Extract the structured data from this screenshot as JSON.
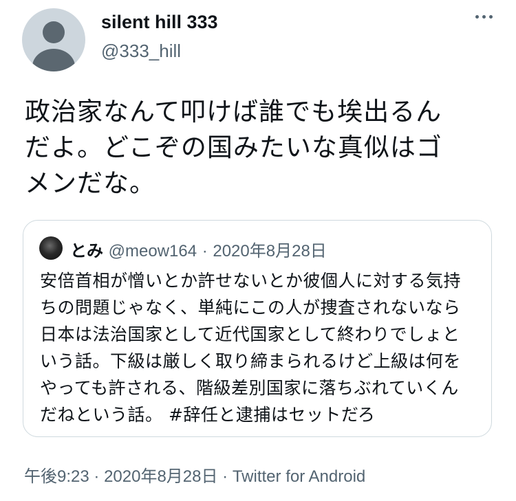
{
  "author": {
    "display_name": "silent hill 333",
    "handle": "@333_hill",
    "avatar_icon": "default-profile-icon"
  },
  "menu_icon": "more-horizontal-icon",
  "tweet": {
    "lines": [
      "政治家なんて叩けば誰でも埃出るん",
      "だよ。どこぞの国みたいな真似はゴ",
      "メンだな。"
    ]
  },
  "quote": {
    "name": "とみ",
    "handle": "@meow164",
    "separator": "·",
    "date": "2020年8月28日",
    "lines": [
      "安倍首相が憎いとか許せないとか彼個人に対する気持",
      "ちの問題じゃなく、単純にこの人が捜査されないなら",
      "日本は法治国家として近代国家として終わりでしょと",
      "いう話。下級は厳しく取り締まられるけど上級は何を",
      "やっても許される、階級差別国家に落ちぶれていくん",
      "だねという話。 #辞任と逮捕はセットだろ"
    ]
  },
  "meta": {
    "time": "午後9:23",
    "separator": "·",
    "date": "2020年8月28日",
    "source": "Twitter for Android"
  }
}
